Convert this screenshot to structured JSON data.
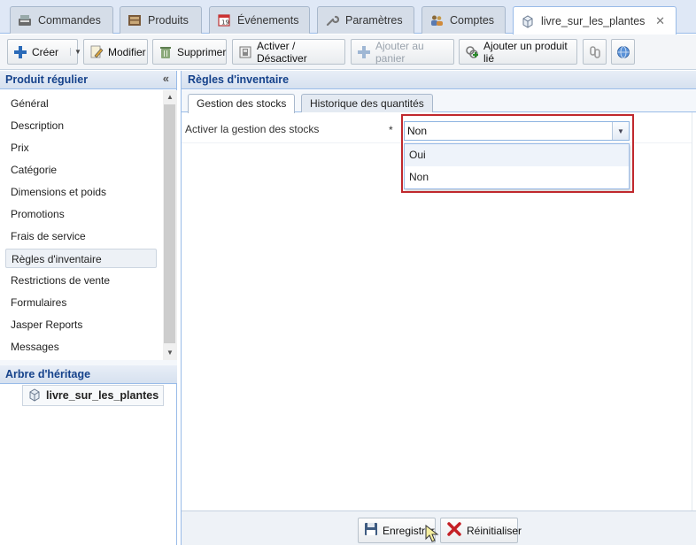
{
  "top_tabs": [
    {
      "label": "Commandes",
      "icon": "register-icon"
    },
    {
      "label": "Produits",
      "icon": "box-icon"
    },
    {
      "label": "Événements",
      "icon": "calendar-icon"
    },
    {
      "label": "Paramètres",
      "icon": "wrench-icon"
    },
    {
      "label": "Comptes",
      "icon": "users-icon"
    },
    {
      "label": "livre_sur_les_plantes",
      "icon": "product-icon",
      "active": true
    }
  ],
  "toolbar": {
    "create": "Créer",
    "modify": "Modifier",
    "delete": "Supprimer",
    "toggle": "Activer / Désactiver",
    "add_cart": "Ajouter au panier",
    "add_linked": "Ajouter un produit lié"
  },
  "left_panel": {
    "title": "Produit régulier",
    "items": [
      "Général",
      "Description",
      "Prix",
      "Catégorie",
      "Dimensions et poids",
      "Promotions",
      "Frais de service",
      "Règles d'inventaire",
      "Restrictions de vente",
      "Formulaires",
      "Jasper Reports",
      "Messages"
    ],
    "selected_index": 7
  },
  "heritage": {
    "title": "Arbre d'héritage",
    "item": "livre_sur_les_plantes"
  },
  "main": {
    "title": "Règles d'inventaire",
    "tabs": [
      "Gestion des stocks",
      "Historique des quantités"
    ],
    "field_label": "Activer la gestion des stocks",
    "required_mark": "*",
    "field_value": "Non",
    "options": [
      "Oui",
      "Non"
    ]
  },
  "bottom": {
    "save": "Enregistrer",
    "reset": "Réinitialiser"
  },
  "colors": {
    "accent": "#15428b",
    "border": "#99bbe8",
    "highlight": "#c0282d"
  }
}
